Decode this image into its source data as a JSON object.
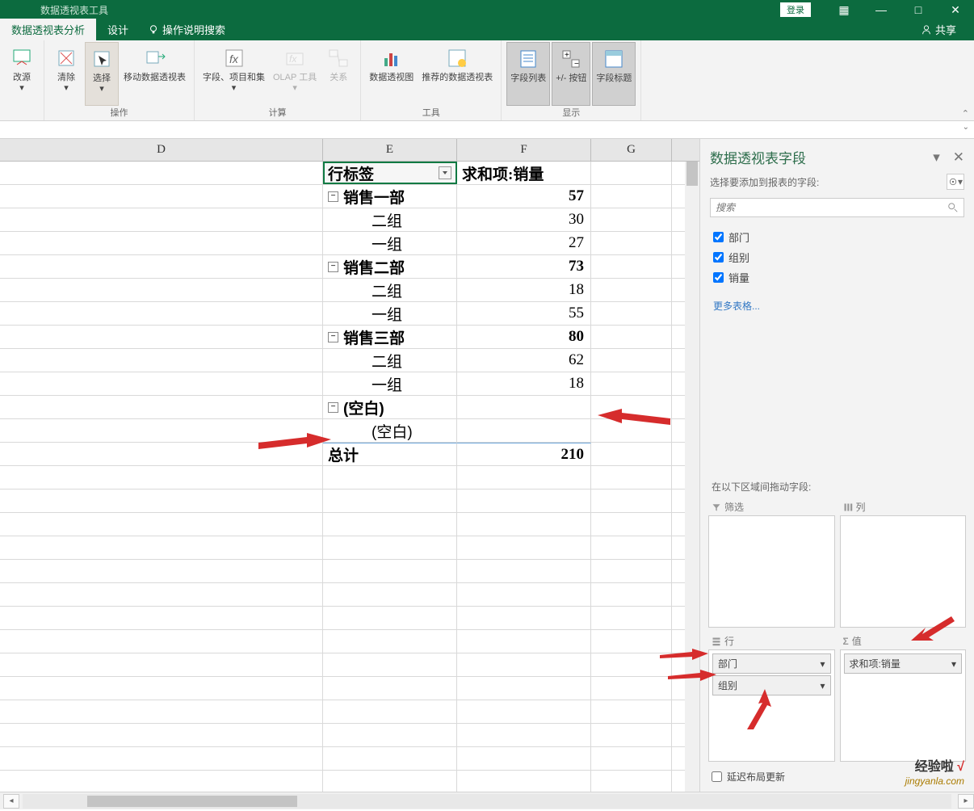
{
  "titlebar": {
    "tool_title": "数据透视表工具",
    "login": "登录",
    "btn_grid": "▦",
    "btn_min": "—",
    "btn_max": "□",
    "btn_close": "✕"
  },
  "tabs": {
    "analyze": "数据透视表分析",
    "design": "设计",
    "tell_me": "操作说明搜索",
    "share": "共享"
  },
  "ribbon": {
    "change_source": "改源",
    "clear": "清除",
    "select": "选择",
    "move": "移动数据透视表",
    "group_operate": "操作",
    "fields_items": "字段、项目和集",
    "olap": "OLAP 工具",
    "relations": "关系",
    "group_calc": "计算",
    "pivot_chart": "数据透视图",
    "recommended": "推荐的数据透视表",
    "group_tools": "工具",
    "field_list": "字段列表",
    "pm_buttons": "+/- 按钮",
    "field_headers": "字段标题",
    "group_show": "显示"
  },
  "columns": {
    "D": "D",
    "E": "E",
    "F": "F",
    "G": "G"
  },
  "pivot": {
    "row_label": "行标签",
    "value_header": "求和项:销量",
    "rows": [
      {
        "type": "group",
        "label": "销售一部",
        "value": "57"
      },
      {
        "type": "item",
        "label": "二组",
        "value": "30"
      },
      {
        "type": "item",
        "label": "一组",
        "value": "27"
      },
      {
        "type": "group",
        "label": "销售二部",
        "value": "73"
      },
      {
        "type": "item",
        "label": "二组",
        "value": "18"
      },
      {
        "type": "item",
        "label": "一组",
        "value": "55"
      },
      {
        "type": "group",
        "label": "销售三部",
        "value": "80"
      },
      {
        "type": "item",
        "label": "二组",
        "value": "62"
      },
      {
        "type": "item",
        "label": "一组",
        "value": "18"
      },
      {
        "type": "group",
        "label": "(空白)",
        "value": ""
      },
      {
        "type": "item",
        "label": "(空白)",
        "value": ""
      }
    ],
    "total_label": "总计",
    "total_value": "210"
  },
  "fieldpane": {
    "title": "数据透视表字段",
    "subtitle": "选择要添加到报表的字段:",
    "search_placeholder": "搜索",
    "fields": [
      "部门",
      "组别",
      "销量"
    ],
    "more_tables": "更多表格...",
    "drag_label": "在以下区域间拖动字段:",
    "area_filter": "筛选",
    "area_columns": "列",
    "area_rows": "行",
    "area_values": "值",
    "row_chips": [
      "部门",
      "组别"
    ],
    "value_chips": [
      "求和项:销量"
    ],
    "defer_layout": "延迟布局更新"
  },
  "watermark": {
    "zh_a": "经验啦",
    "zh_b": "√",
    "en": "jingyanla.com"
  }
}
